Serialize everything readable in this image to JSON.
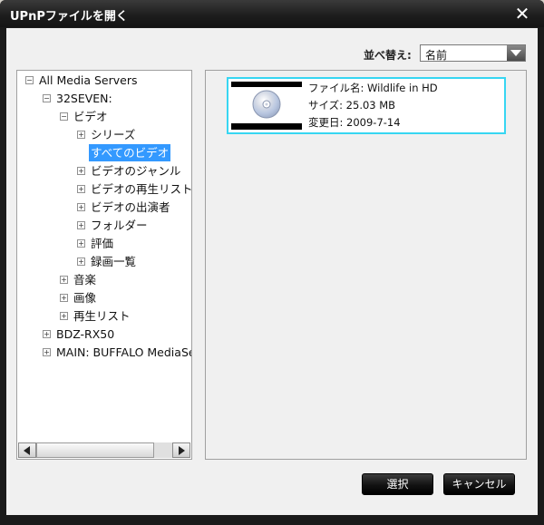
{
  "window": {
    "title": "UPnPファイルを開く",
    "close_glyph": "✕"
  },
  "sort": {
    "label": "並べ替え:",
    "selected": "名前"
  },
  "tree": {
    "root": "All Media Servers",
    "server1": "32SEVEN:",
    "video": "ビデオ",
    "series": "シリーズ",
    "all_videos": "すべてのビデオ",
    "genre": "ビデオのジャンル",
    "playlist": "ビデオの再生リスト",
    "cast": "ビデオの出演者",
    "folder": "フォルダー",
    "rating": "評価",
    "recordings": "録画一覧",
    "music": "音楽",
    "pictures": "画像",
    "playlists": "再生リスト",
    "server2": "BDZ-RX50",
    "server3": "MAIN: BUFFALO MediaSe"
  },
  "file": {
    "name_line": "ファイル名:  Wildlife in HD",
    "size_line": "サイズ:  25.03 MB",
    "date_line": "変更日:  2009-7-14",
    "icon": "disc-icon"
  },
  "buttons": {
    "ok": "選択",
    "cancel": "キャンセル"
  },
  "colors": {
    "selection": "#3399ff",
    "card_border": "#37d6f2",
    "frame": "#1a1a1a"
  }
}
